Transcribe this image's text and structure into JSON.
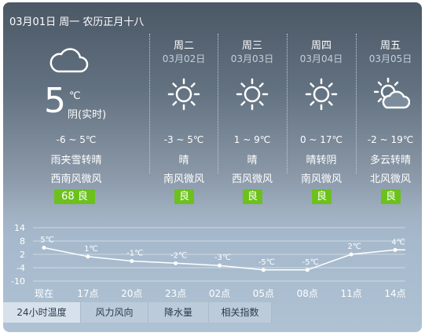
{
  "header": {
    "date_line": "03月01日 周一 农历正月十八"
  },
  "today": {
    "icon": "cloudy-icon",
    "temp": "5",
    "unit": "℃",
    "condition_now": "阴(实时)",
    "range": "-6 ~ 5℃",
    "weather": "雨夹雪转晴",
    "wind": "西南风微风",
    "aqi_value": "68",
    "aqi_level": "良"
  },
  "forecast": [
    {
      "day": "周二",
      "date": "03月02日",
      "icon": "sunny-icon",
      "range": "-3 ~ 5℃",
      "weather": "晴",
      "wind": "南风微风",
      "aqi": "良"
    },
    {
      "day": "周三",
      "date": "03月03日",
      "icon": "sunny-icon",
      "range": "1 ~ 9℃",
      "weather": "晴",
      "wind": "西风微风",
      "aqi": "良"
    },
    {
      "day": "周四",
      "date": "03月04日",
      "icon": "sunny-icon",
      "range": "0 ~ 17℃",
      "weather": "晴转阴",
      "wind": "南风微风",
      "aqi": "良"
    },
    {
      "day": "周五",
      "date": "03月05日",
      "icon": "partly-cloudy-icon",
      "range": "-2 ~ 19℃",
      "weather": "多云转晴",
      "wind": "北风微风",
      "aqi": "良"
    }
  ],
  "chart_data": {
    "type": "line",
    "categories": [
      "现在",
      "17点",
      "20点",
      "23点",
      "02点",
      "05点",
      "08点",
      "11点",
      "14点"
    ],
    "values": [
      5,
      1,
      -1,
      -2,
      -3,
      -5,
      -5,
      2,
      4
    ],
    "value_labels": [
      "5℃",
      "1℃",
      "-1℃",
      "-2℃",
      "-3℃",
      "-5℃",
      "-5℃",
      "2℃",
      "4℃"
    ],
    "y_ticks": [
      "14",
      "8",
      "2",
      "-4",
      "-10"
    ],
    "ylim": [
      -10,
      14
    ],
    "grid": true
  },
  "tabs": [
    "24小时温度",
    "风力风向",
    "降水量",
    "相关指数"
  ],
  "colors": {
    "aqi_good": "#6cc11c",
    "line": "#ffffff"
  }
}
